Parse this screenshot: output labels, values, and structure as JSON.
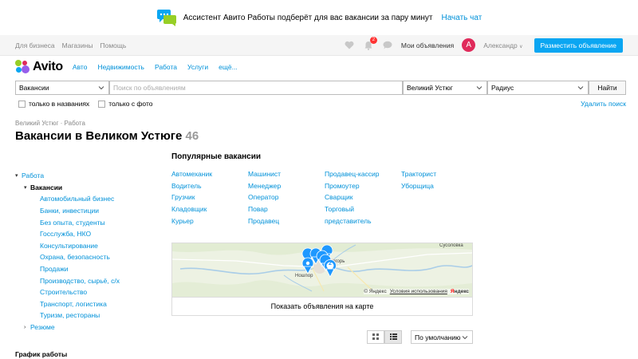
{
  "promo": {
    "text": "Ассистент Авито Работы подберёт для вас вакансии за пару минут",
    "link": "Начать чат"
  },
  "topbar": {
    "links": [
      "Для бизнеса",
      "Магазины",
      "Помощь"
    ],
    "notifications_count": "2",
    "my_ads": "Мои объявления",
    "avatar_letter": "А",
    "username": "Александр",
    "post_button": "Разместить объявление"
  },
  "logo": {
    "text": "Avito"
  },
  "categories": [
    "Авто",
    "Недвижимость",
    "Работа",
    "Услуги",
    "ещё..."
  ],
  "search": {
    "category_value": "Вакансии",
    "query_placeholder": "Поиск по объявлениям",
    "location_value": "Великий Устюг",
    "radius_value": "Радиус",
    "submit_label": "Найти"
  },
  "filters": {
    "titles_only": "только в названиях",
    "with_photo": "только с фото",
    "clear": "Удалить поиск"
  },
  "breadcrumb": "Великий Устюг · Работа",
  "page_title": {
    "text": "Вакансии в Великом Устюге",
    "count": "46"
  },
  "sidebar": {
    "root": "Работа",
    "current": "Вакансии",
    "subcategories": [
      "Автомобильный бизнес",
      "Банки, инвестиции",
      "Без опыта, студенты",
      "Госслужба, НКО",
      "Консультирование",
      "Охрана, безопасность",
      "Продажи",
      "Производство, сырьё, с/х",
      "Строительство",
      "Транспорт, логистика",
      "Туризм, рестораны"
    ],
    "resume": "Резюме",
    "schedule_heading": "График работы"
  },
  "popular": {
    "title": "Популярные вакансии",
    "columns": [
      [
        "Автомеханик",
        "Водитель",
        "Грузчик",
        "Кладовщик",
        "Курьер"
      ],
      [
        "Машинист",
        "Менеджер",
        "Оператор",
        "Повар",
        "Продавец"
      ],
      [
        "Продавец-кассир",
        "Промоутер",
        "Сварщик",
        "Торговый",
        "представитель"
      ],
      [
        "Тракторист",
        "Уборщица"
      ]
    ]
  },
  "map": {
    "labels": [
      "Сусоловка",
      "Ношпор",
      "югорь"
    ],
    "cluster_count": "2",
    "copyright": "© Яндекс",
    "terms": "Условия использования",
    "brand_ya": "Я",
    "brand_rest": "ндекс",
    "show_button": "Показать объявления на карте"
  },
  "sort": {
    "value": "По умолчанию"
  },
  "colors": {
    "accent": "#0091d9",
    "button": "#0aa6f2",
    "avatar": "#e02b5b",
    "pin": "#1e98ff"
  }
}
